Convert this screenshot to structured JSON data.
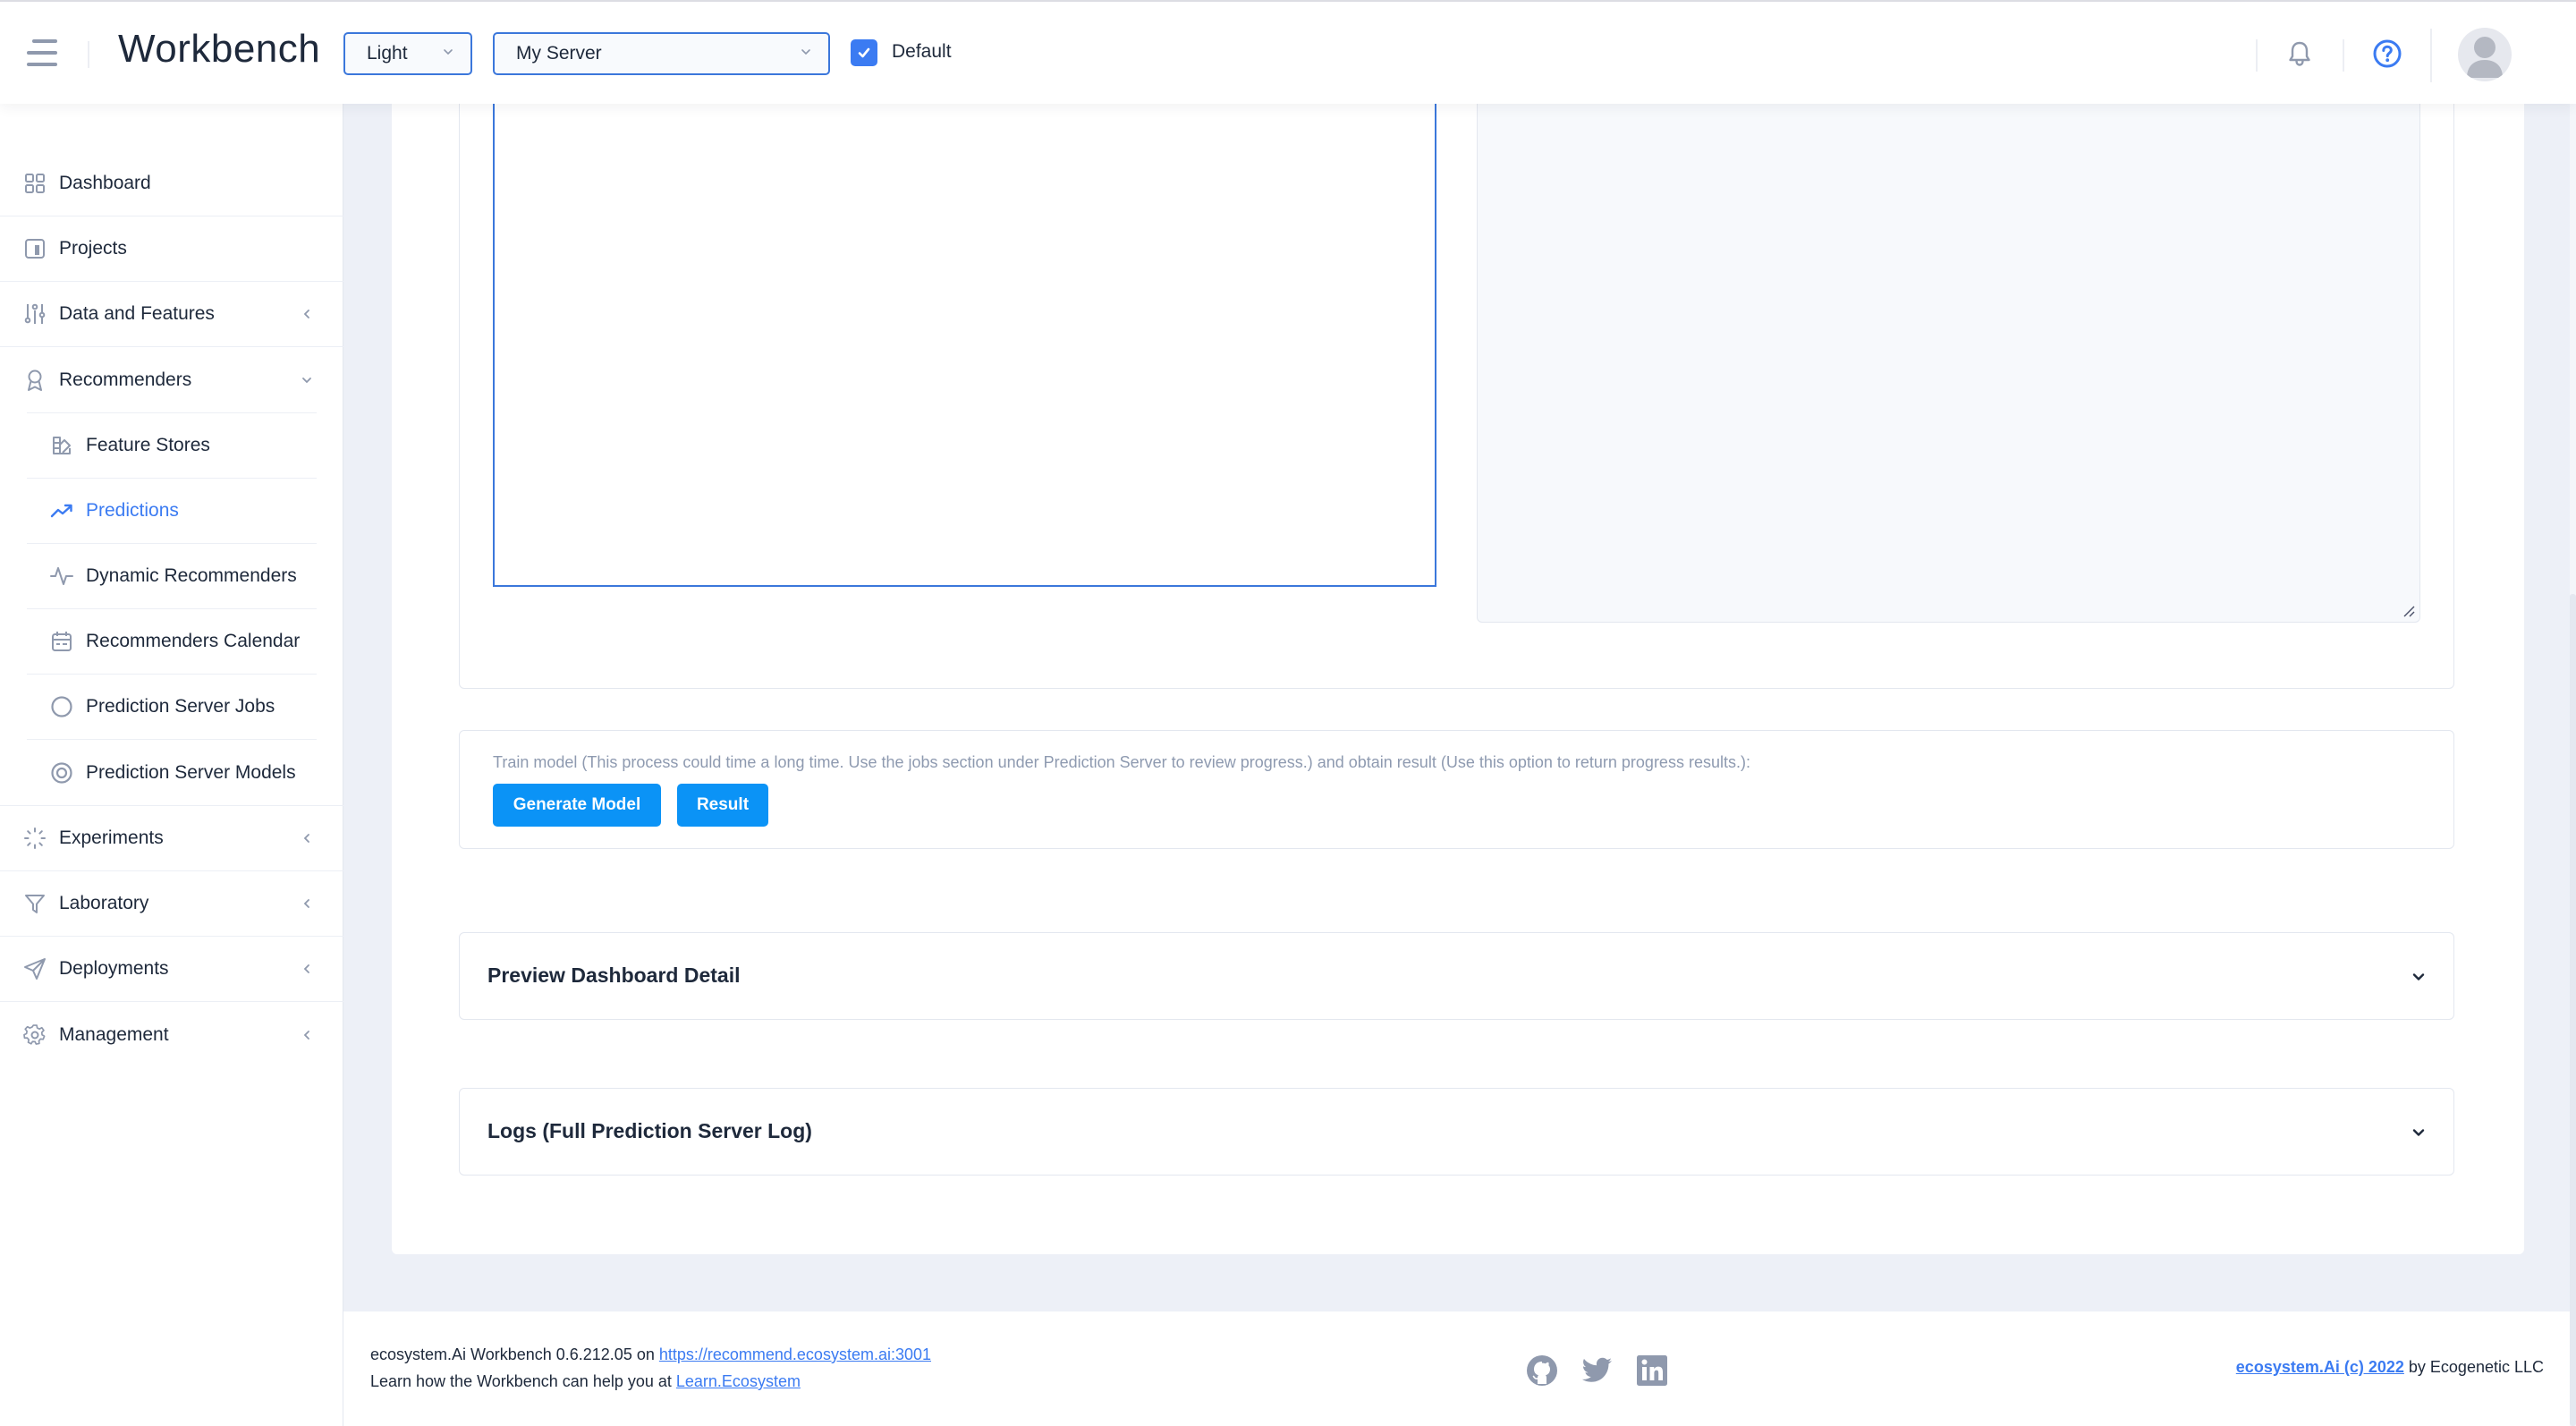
{
  "header": {
    "app_title": "Workbench",
    "theme_select": {
      "value": "Light"
    },
    "server_select": {
      "value": "My Server"
    },
    "default_checkbox": {
      "label": "Default",
      "checked": true
    },
    "icons": [
      "menu-icon",
      "bell-icon",
      "help-icon",
      "avatar"
    ]
  },
  "sidebar": {
    "items": [
      {
        "label": "Dashboard",
        "icon": "grid-icon",
        "expandable": false
      },
      {
        "label": "Projects",
        "icon": "project-board-icon",
        "expandable": false
      },
      {
        "label": "Data and Features",
        "icon": "sliders-icon",
        "expandable": true,
        "expanded": false
      },
      {
        "label": "Recommenders",
        "icon": "award-icon",
        "expandable": true,
        "expanded": true,
        "children": [
          {
            "label": "Feature Stores",
            "icon": "feature-store-icon"
          },
          {
            "label": "Predictions",
            "icon": "trending-up-icon",
            "active": true
          },
          {
            "label": "Dynamic Recommenders",
            "icon": "activity-icon"
          },
          {
            "label": "Recommenders Calendar",
            "icon": "calendar-icon"
          },
          {
            "label": "Prediction Server Jobs",
            "icon": "circle-icon"
          },
          {
            "label": "Prediction Server Models",
            "icon": "target-icon"
          }
        ]
      },
      {
        "label": "Experiments",
        "icon": "loader-icon",
        "expandable": true,
        "expanded": false
      },
      {
        "label": "Laboratory",
        "icon": "filter-icon",
        "expandable": true,
        "expanded": false
      },
      {
        "label": "Deployments",
        "icon": "send-icon",
        "expandable": true,
        "expanded": false
      },
      {
        "label": "Management",
        "icon": "gear-icon",
        "expandable": true,
        "expanded": false
      }
    ]
  },
  "main": {
    "editor_left": {
      "value": ""
    },
    "editor_right": {
      "value": ""
    },
    "actions": {
      "description": "Train model (This process could time a long time. Use the jobs section under Prediction Server to review progress.) and obtain result (Use this option to return progress results.):",
      "generate_label": "Generate Model",
      "result_label": "Result"
    },
    "accordions": [
      {
        "title": "Preview Dashboard Detail",
        "expanded": false
      },
      {
        "title": "Logs (Full Prediction Server Log)",
        "expanded": false
      }
    ]
  },
  "footer": {
    "version_prefix": "ecosystem.Ai Workbench 0.6.212.05 on ",
    "server_link": "https://recommend.ecosystem.ai:3001",
    "learn_prefix": "Learn how the Workbench can help you at ",
    "learn_link": "Learn.Ecosystem",
    "social": [
      "github-icon",
      "twitter-icon",
      "linkedin-icon"
    ],
    "copyright_link": "ecosystem.Ai (c) 2022",
    "copyright_suffix": " by Ecogenetic LLC"
  },
  "colors": {
    "accent": "#3b7bf2",
    "button": "#0b93f6",
    "text": "#1e293b",
    "muted": "#8e9ab0",
    "background": "#edf0f7"
  }
}
